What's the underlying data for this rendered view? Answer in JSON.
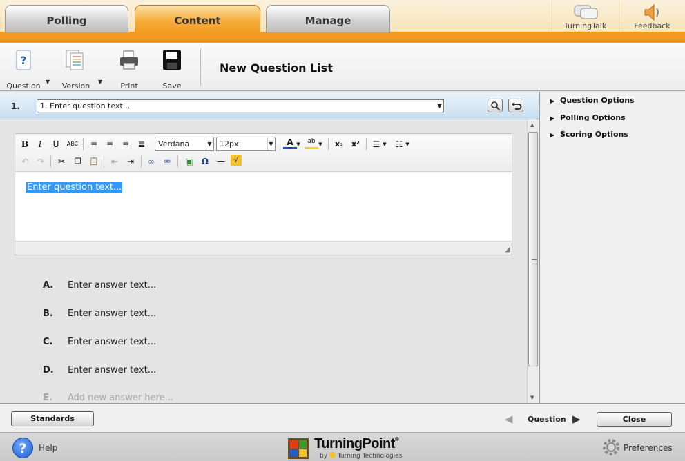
{
  "tabs": [
    {
      "label": "Polling",
      "active": false
    },
    {
      "label": "Content",
      "active": true
    },
    {
      "label": "Manage",
      "active": false
    }
  ],
  "top_buttons": {
    "turningtalk": "TurningTalk",
    "feedback": "Feedback"
  },
  "toolbar": {
    "question": "Question",
    "version": "Version",
    "print": "Print",
    "save": "Save",
    "title": "New Question List"
  },
  "question_row": {
    "number": "1.",
    "selected": "1. Enter question text..."
  },
  "editor": {
    "font": "Verdana",
    "size": "12px",
    "content": "Enter question text..."
  },
  "answers": [
    {
      "letter": "A.",
      "text": "Enter answer text..."
    },
    {
      "letter": "B.",
      "text": "Enter answer text..."
    },
    {
      "letter": "C.",
      "text": "Enter answer text..."
    },
    {
      "letter": "D.",
      "text": "Enter answer text..."
    },
    {
      "letter": "E.",
      "text": "Add new answer here..."
    }
  ],
  "right_panel": {
    "options": [
      "Question Options",
      "Polling Options",
      "Scoring Options"
    ]
  },
  "bottom": {
    "standards": "Standards",
    "nav_label": "Question",
    "close": "Close"
  },
  "footer": {
    "help": "Help",
    "brand": "TurningPoint",
    "brand_reg": "®",
    "brand_by": "by",
    "brand_company": "Turning Technologies",
    "preferences": "Preferences"
  },
  "colors": {
    "accent_orange": "#f29a1f",
    "selection_blue": "#3399ff",
    "question_row_blue": "#c9deef"
  }
}
